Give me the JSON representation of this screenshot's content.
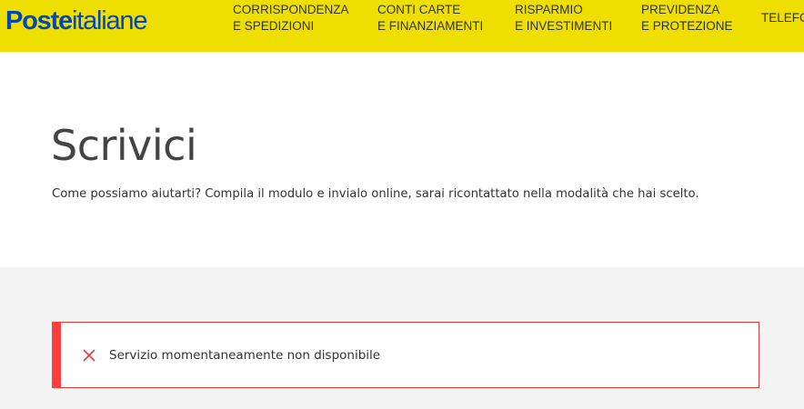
{
  "header": {
    "logo": {
      "bold": "Poste",
      "light": "italiane"
    },
    "nav": [
      {
        "line1": "CORRISPONDENZA",
        "line2": "E SPEDIZIONI"
      },
      {
        "line1": "CONTI CARTE",
        "line2": "E FINANZIAMENTI"
      },
      {
        "line1": "RISPARMIO",
        "line2": "E INVESTIMENTI"
      },
      {
        "line1": "PREVIDENZA",
        "line2": "E PROTEZIONE"
      },
      {
        "line1": "TELEFO",
        "line2": ""
      }
    ]
  },
  "hero": {
    "title": "Scrivici",
    "subtitle": "Come possiamo aiutarti? Compila il modulo e invialo online, sarai ricontattato nella modalità che hai scelto."
  },
  "alert": {
    "icon": "close-icon",
    "message": "Servizio momentaneamente non disponibile"
  },
  "colors": {
    "header_bg": "#eedf00",
    "logo_blue": "#0047bb",
    "alert_red": "#ff3d3d",
    "content_bg": "#f4f4f4"
  }
}
